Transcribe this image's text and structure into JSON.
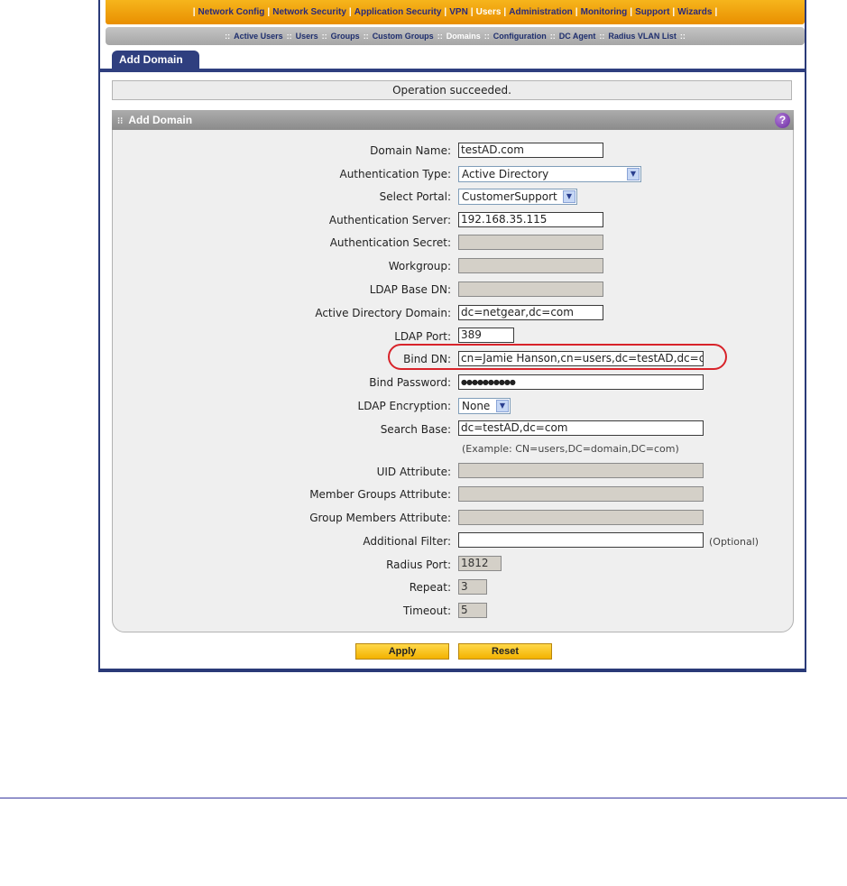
{
  "top_nav": {
    "items": [
      {
        "label": "Network Config",
        "active": false
      },
      {
        "label": "Network Security",
        "active": false
      },
      {
        "label": "Application Security",
        "active": false
      },
      {
        "label": "VPN",
        "active": false
      },
      {
        "label": "Users",
        "active": true
      },
      {
        "label": "Administration",
        "active": false
      },
      {
        "label": "Monitoring",
        "active": false
      },
      {
        "label": "Support",
        "active": false
      },
      {
        "label": "Wizards",
        "active": false
      }
    ]
  },
  "sub_nav": {
    "items": [
      {
        "label": "Active Users",
        "active": false
      },
      {
        "label": "Users",
        "active": false
      },
      {
        "label": "Groups",
        "active": false
      },
      {
        "label": "Custom Groups",
        "active": false
      },
      {
        "label": "Domains",
        "active": true
      },
      {
        "label": "Configuration",
        "active": false
      },
      {
        "label": "DC Agent",
        "active": false
      },
      {
        "label": "Radius VLAN List",
        "active": false
      }
    ]
  },
  "tab": {
    "label": "Add Domain"
  },
  "status": {
    "message": "Operation succeeded."
  },
  "section": {
    "title": "Add Domain",
    "help_glyph": "?"
  },
  "form": {
    "domain_name": {
      "label": "Domain Name:",
      "value": "testAD.com"
    },
    "auth_type": {
      "label": "Authentication Type:",
      "value": "Active Directory"
    },
    "portal": {
      "label": "Select Portal:",
      "value": "CustomerSupport"
    },
    "auth_server": {
      "label": "Authentication Server:",
      "value": "192.168.35.115"
    },
    "auth_secret": {
      "label": "Authentication Secret:",
      "value": ""
    },
    "workgroup": {
      "label": "Workgroup:",
      "value": ""
    },
    "ldap_base_dn": {
      "label": "LDAP Base DN:",
      "value": ""
    },
    "ad_domain": {
      "label": "Active Directory Domain:",
      "value": "dc=netgear,dc=com"
    },
    "ldap_port": {
      "label": "LDAP Port:",
      "value": "389"
    },
    "bind_dn": {
      "label": "Bind DN:",
      "value": "cn=Jamie Hanson,cn=users,dc=testAD,dc=co"
    },
    "bind_password": {
      "label": "Bind Password:",
      "value": "●●●●●●●●●●"
    },
    "ldap_encryption": {
      "label": "LDAP Encryption:",
      "value": "None"
    },
    "search_base": {
      "label": "Search Base:",
      "value": "dc=testAD,dc=com",
      "example": "(Example: CN=users,DC=domain,DC=com)"
    },
    "uid_attr": {
      "label": "UID Attribute:",
      "value": ""
    },
    "member_groups_attr": {
      "label": "Member Groups Attribute:",
      "value": ""
    },
    "group_members_attr": {
      "label": "Group Members Attribute:",
      "value": ""
    },
    "additional_filter": {
      "label": "Additional Filter:",
      "value": "",
      "note": "(Optional)"
    },
    "radius_port": {
      "label": "Radius Port:",
      "value": "1812"
    },
    "repeat": {
      "label": "Repeat:",
      "value": "3"
    },
    "timeout": {
      "label": "Timeout:",
      "value": "5"
    }
  },
  "buttons": {
    "apply": "Apply",
    "reset": "Reset"
  },
  "icons": {
    "dropdown": "chevron-down-icon",
    "help": "help-icon",
    "grip": "grip-icon"
  },
  "colors": {
    "nav_orange": "#f0a010",
    "nav_active": "#ffffff",
    "frame_blue": "#2f3f7f",
    "highlight_red": "#d8232a",
    "button_yellow": "#f8c820"
  }
}
